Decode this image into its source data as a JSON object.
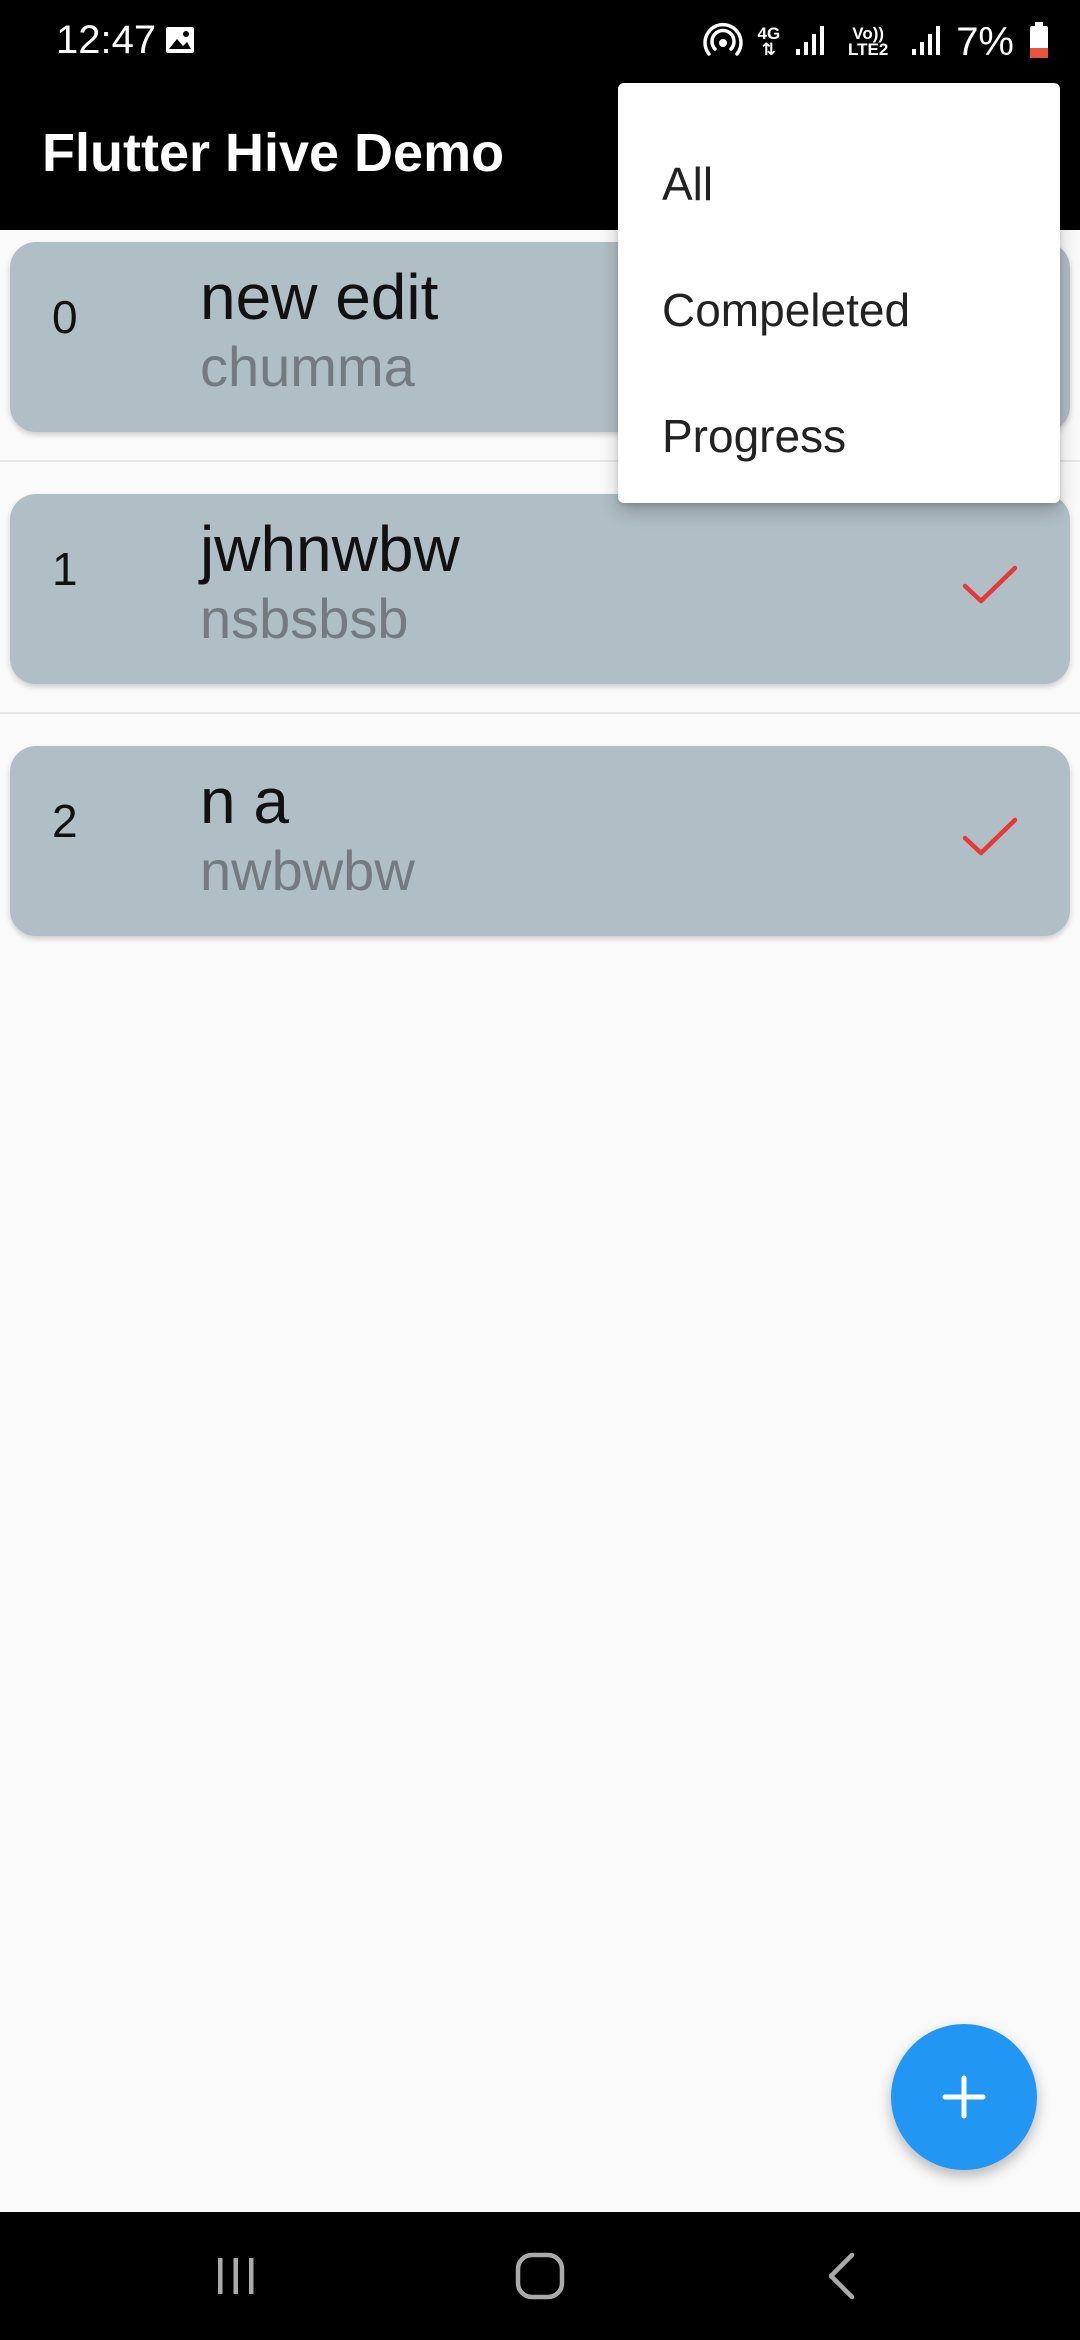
{
  "status_bar": {
    "time": "12:47",
    "network_4g": "4G",
    "network_volte": "Vo)) LTE2",
    "battery": "7%",
    "battery_color": "#e6553a",
    "icons": [
      "gallery-icon",
      "hotspot-icon",
      "data-arrows-icon",
      "signal-icon",
      "signal-icon",
      "battery-icon"
    ]
  },
  "app_bar": {
    "title": "Flutter Hive Demo"
  },
  "list": {
    "items": [
      {
        "index": "0",
        "title": "new edit",
        "subtitle": "chumma",
        "completed": false
      },
      {
        "index": "1",
        "title": "jwhnwbw",
        "subtitle": "nsbsbsb",
        "completed": true
      },
      {
        "index": "2",
        "title": "n a",
        "subtitle": "nwbwbw",
        "completed": true
      }
    ],
    "card_color": "#b0bec5",
    "check_color": "#e53935"
  },
  "filter_menu": {
    "options": [
      "All",
      "Compeleted",
      "Progress"
    ]
  },
  "fab": {
    "icon": "add-icon",
    "color": "#2196f3"
  },
  "nav_bar": {
    "icons": [
      "recents-icon",
      "home-icon",
      "back-icon"
    ]
  }
}
